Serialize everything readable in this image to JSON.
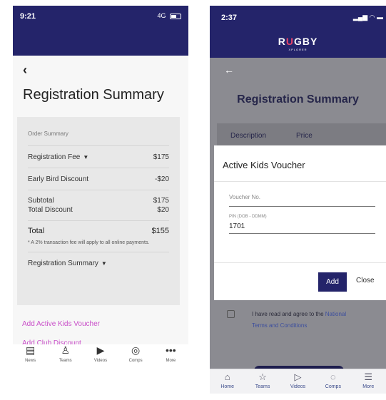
{
  "left": {
    "status": {
      "time": "9:21",
      "network": "4G"
    },
    "page_title": "Registration Summary",
    "order_summary": {
      "title": "Order Summary",
      "registration_fee": {
        "label": "Registration Fee",
        "value": "$175"
      },
      "early_bird": {
        "label": "Early Bird Discount",
        "value": "-$20"
      },
      "subtotal": {
        "label": "Subtotal",
        "value": "$175"
      },
      "total_discount": {
        "label": "Total Discount",
        "value": "$20"
      },
      "total": {
        "label": "Total",
        "value": "$155"
      },
      "note": "* A 2% transaction fee will apply to all online payments.",
      "registration_summary": "Registration Summary"
    },
    "links": {
      "voucher": "Add Active Kids Voucher",
      "club_discount": "Add Club Discount"
    },
    "tabs": [
      "News",
      "Teams",
      "Videos",
      "Comps",
      "More"
    ]
  },
  "right": {
    "status": {
      "time": "2:37"
    },
    "logo": {
      "r": "R",
      "u": "U",
      "gby": "GBY",
      "sub": "XPLORER"
    },
    "page_title": "Registration Summary",
    "table_header": {
      "description": "Description",
      "price": "Price"
    },
    "dialog": {
      "title": "Active Kids Voucher",
      "voucher_placeholder": "Voucher No.",
      "pin_label": "PIN (DOB - DDMM)",
      "pin_value": "1701",
      "add": "Add",
      "close": "Close"
    },
    "terms": {
      "text": "I have read and agree to the",
      "link1": "National",
      "link2": "Terms and Conditions"
    },
    "tabs": [
      "Home",
      "Teams",
      "Videos",
      "Comps",
      "More"
    ]
  }
}
